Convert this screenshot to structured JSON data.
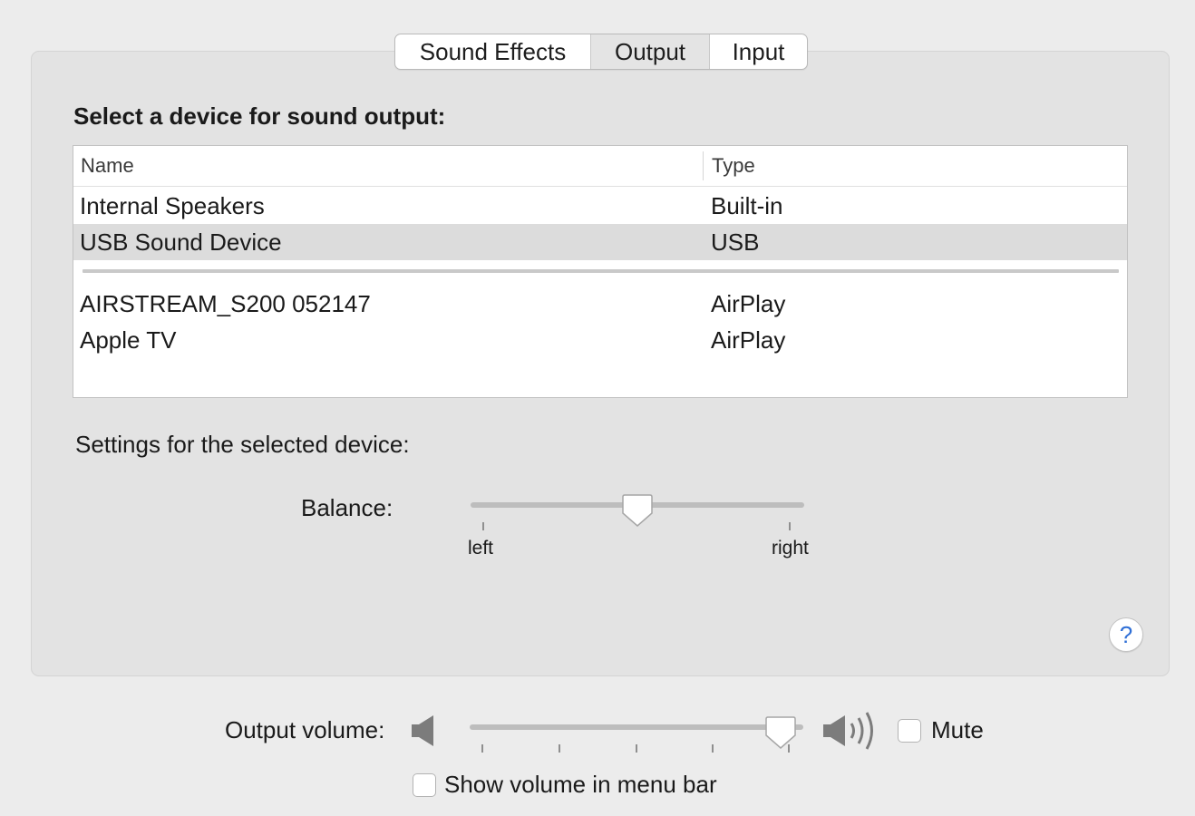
{
  "tabs": [
    {
      "label": "Sound Effects"
    },
    {
      "label": "Output"
    },
    {
      "label": "Input"
    }
  ],
  "selected_tab": "Output",
  "output": {
    "heading": "Select a device for sound output:",
    "columns": {
      "name": "Name",
      "type": "Type"
    },
    "devices": [
      {
        "name": "Internal Speakers",
        "type": "Built-in"
      },
      {
        "name": "USB Sound Device",
        "type": "USB",
        "selected": true
      },
      {
        "name": "AIRSTREAM_S200 052147",
        "type": "AirPlay"
      },
      {
        "name": "Apple TV",
        "type": "AirPlay"
      }
    ],
    "settings_label": "Settings for the selected device:",
    "balance": {
      "label": "Balance:",
      "min_label": "left",
      "max_label": "right",
      "value_fraction": 0.5
    },
    "help_label": "?"
  },
  "volume": {
    "label": "Output volume:",
    "value_fraction": 0.97,
    "min_icon": "speaker-low-icon",
    "max_icon": "speaker-high-icon",
    "mute_label": "Mute",
    "mute_checked": false,
    "menu_bar_label": "Show volume in menu bar",
    "menu_bar_checked": false
  },
  "colors": {
    "window_bg": "#ececec",
    "panel_bg": "#e3e3e3",
    "selected_row": "#dcdcdc",
    "help_accent": "#2f6fd6"
  }
}
